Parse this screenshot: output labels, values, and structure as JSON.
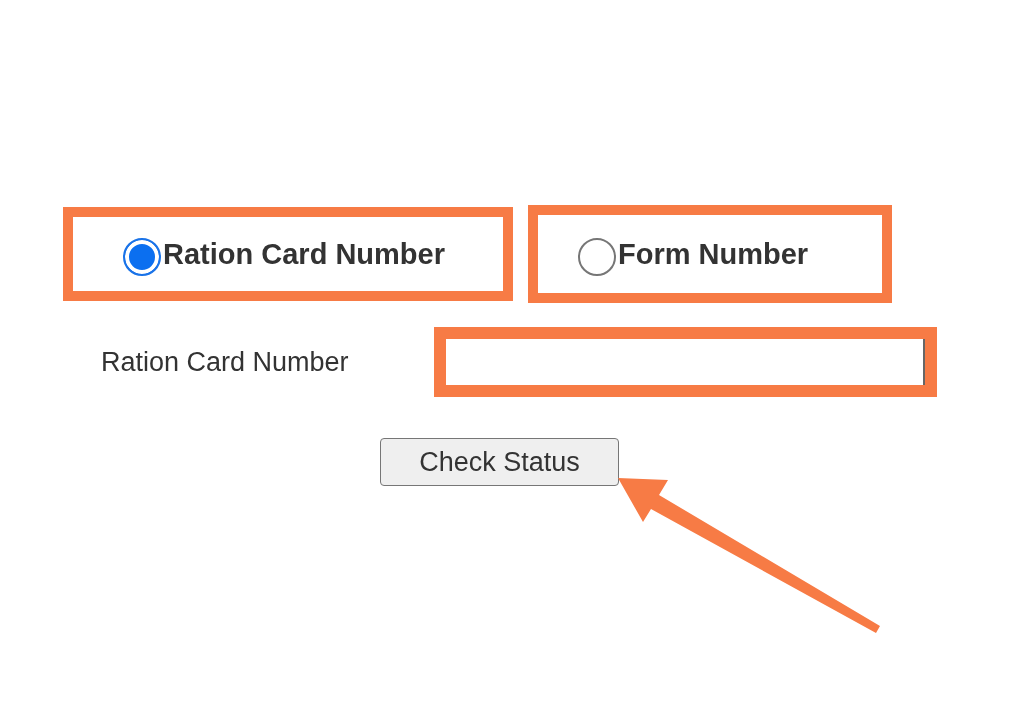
{
  "options": [
    {
      "label": "Ration Card Number",
      "selected": true,
      "highlighted": true
    },
    {
      "label": "Form Number",
      "selected": false,
      "highlighted": true
    }
  ],
  "field": {
    "label": "Ration Card Number",
    "highlighted": true
  },
  "button": {
    "label": "Check Status",
    "pointed_at": true
  }
}
